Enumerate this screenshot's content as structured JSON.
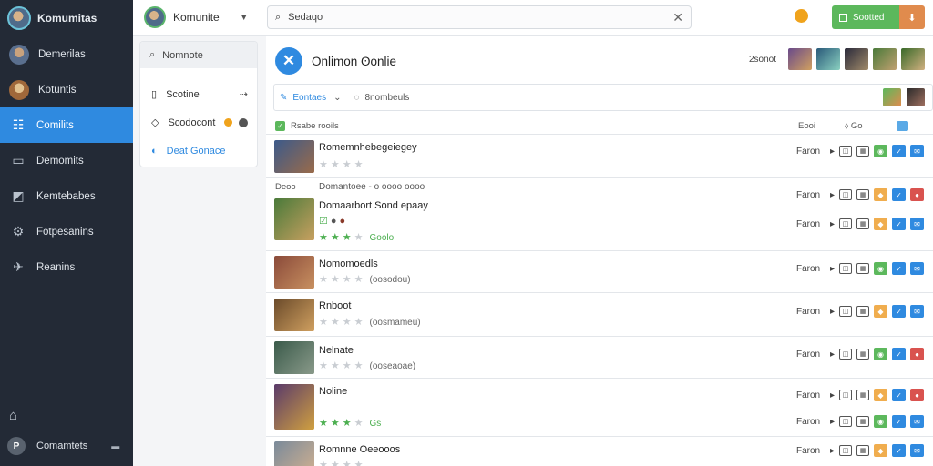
{
  "app": {
    "title": "Komumitas"
  },
  "sidebar": {
    "items": [
      {
        "label": "Demerilas",
        "icon": "avatar"
      },
      {
        "label": "Kotuntis",
        "icon": "avatar"
      },
      {
        "label": "Comilits",
        "icon": "list-icon",
        "active": true
      },
      {
        "label": "Demomits",
        "icon": "monitor-icon"
      },
      {
        "label": "Kemtebabes",
        "icon": "image-icon"
      },
      {
        "label": "Fotpesanins",
        "icon": "gear-icon"
      },
      {
        "label": "Reanins",
        "icon": "bird-icon"
      }
    ],
    "footer": {
      "badge": "P",
      "label": "Comamtets"
    }
  },
  "topbar": {
    "username": "Komunite",
    "search_value": "Sedaqo",
    "primary_button": "Sootted",
    "colors": {
      "primary": "#5cb85c",
      "secondary": "#e08b4d",
      "notif": "#f0a31c"
    }
  },
  "subpanel": {
    "search_label": "Nomnote",
    "items": [
      {
        "label": "Scotine"
      },
      {
        "label": "Scodocont"
      },
      {
        "label": "Deat Gonace"
      }
    ]
  },
  "main": {
    "title": "Onlimon ʘonlie",
    "count": "2sonot",
    "toolbar": {
      "filter": "Eontaes",
      "second": "8nombeuls"
    },
    "header": {
      "col1": "Rsabe rooils",
      "col2": "Eooi",
      "col3": "Go"
    },
    "rows": [
      {
        "sub": "",
        "name": "Romemnhebegeiegey",
        "stars": 0,
        "extra": "",
        "action": "Faron",
        "colors": [
          "#3c5a8a",
          "#9a6b4a"
        ]
      },
      {
        "sub": "Deoo",
        "subright": "Domantoee - o oooo oooo",
        "name": "Domaarbort Sond epaay",
        "stars": 3,
        "extra": "Goolo",
        "action": "Faron",
        "colors": [
          "#4a7a3a",
          "#c8a060"
        ]
      },
      {
        "sub": "",
        "name": "Nomomoedls",
        "stars": 0,
        "extra": "(oosodou)",
        "action": "Faron",
        "colors": [
          "#8a4a3a",
          "#c89060"
        ]
      },
      {
        "sub": "",
        "name": "Rnboot",
        "stars": 0,
        "extra": "(oosmameu)",
        "action": "Faron",
        "colors": [
          "#6a4a2a",
          "#d0a060"
        ]
      },
      {
        "sub": "",
        "name": "Nelnate",
        "stars": 0,
        "extra": "(ooseaoae)",
        "action": "Faron",
        "colors": [
          "#3a5a4a",
          "#8a9a8a"
        ]
      },
      {
        "sub": "",
        "name": "Noline",
        "stars": 3,
        "extra": "Gs",
        "action": "Faron",
        "colors": [
          "#5a3a6a",
          "#d0a040"
        ]
      },
      {
        "sub": "",
        "name": "Romnne Oeeooos",
        "stars": 0,
        "extra": "",
        "action": "Faron",
        "colors": [
          "#7a8a9a",
          "#d0b090"
        ]
      }
    ]
  }
}
